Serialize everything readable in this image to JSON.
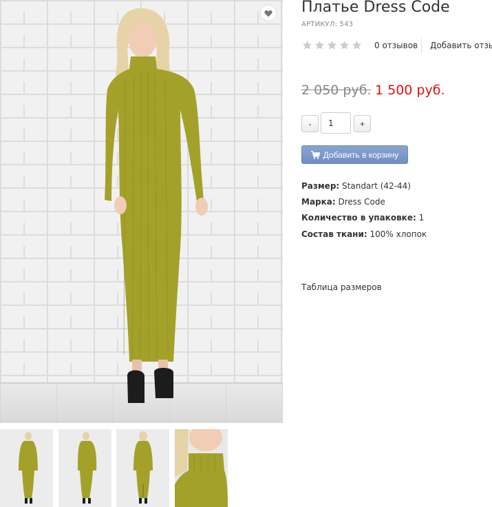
{
  "product": {
    "title": "Платье Dress Code",
    "sku": "АРТИКУЛ: 543",
    "rating": 0,
    "reviews_label": "0 отзывов",
    "add_review_label": "Добавить отзыв",
    "price_old": "2 050 руб.",
    "price_new": "1 500 руб.",
    "quantity": "1",
    "minus_label": "-",
    "plus_label": "+",
    "add_to_cart_label": "Добавить в корзину",
    "specs": [
      {
        "label": "Размер:",
        "value": "Standart (42-44)"
      },
      {
        "label": "Марка:",
        "value": "Dress Code"
      },
      {
        "label": "Количество в упаковке:",
        "value": "1"
      },
      {
        "label": "Состав ткани:",
        "value": "100% хлопок"
      }
    ],
    "size_table_label": "Таблица размеров"
  },
  "colors": {
    "dress": "#9e9d24",
    "price_new": "#e01010",
    "cart_button": "#7694c8",
    "star_empty": "#cccccc"
  },
  "icons": [
    "heart-icon",
    "star-icon",
    "cart-icon"
  ]
}
